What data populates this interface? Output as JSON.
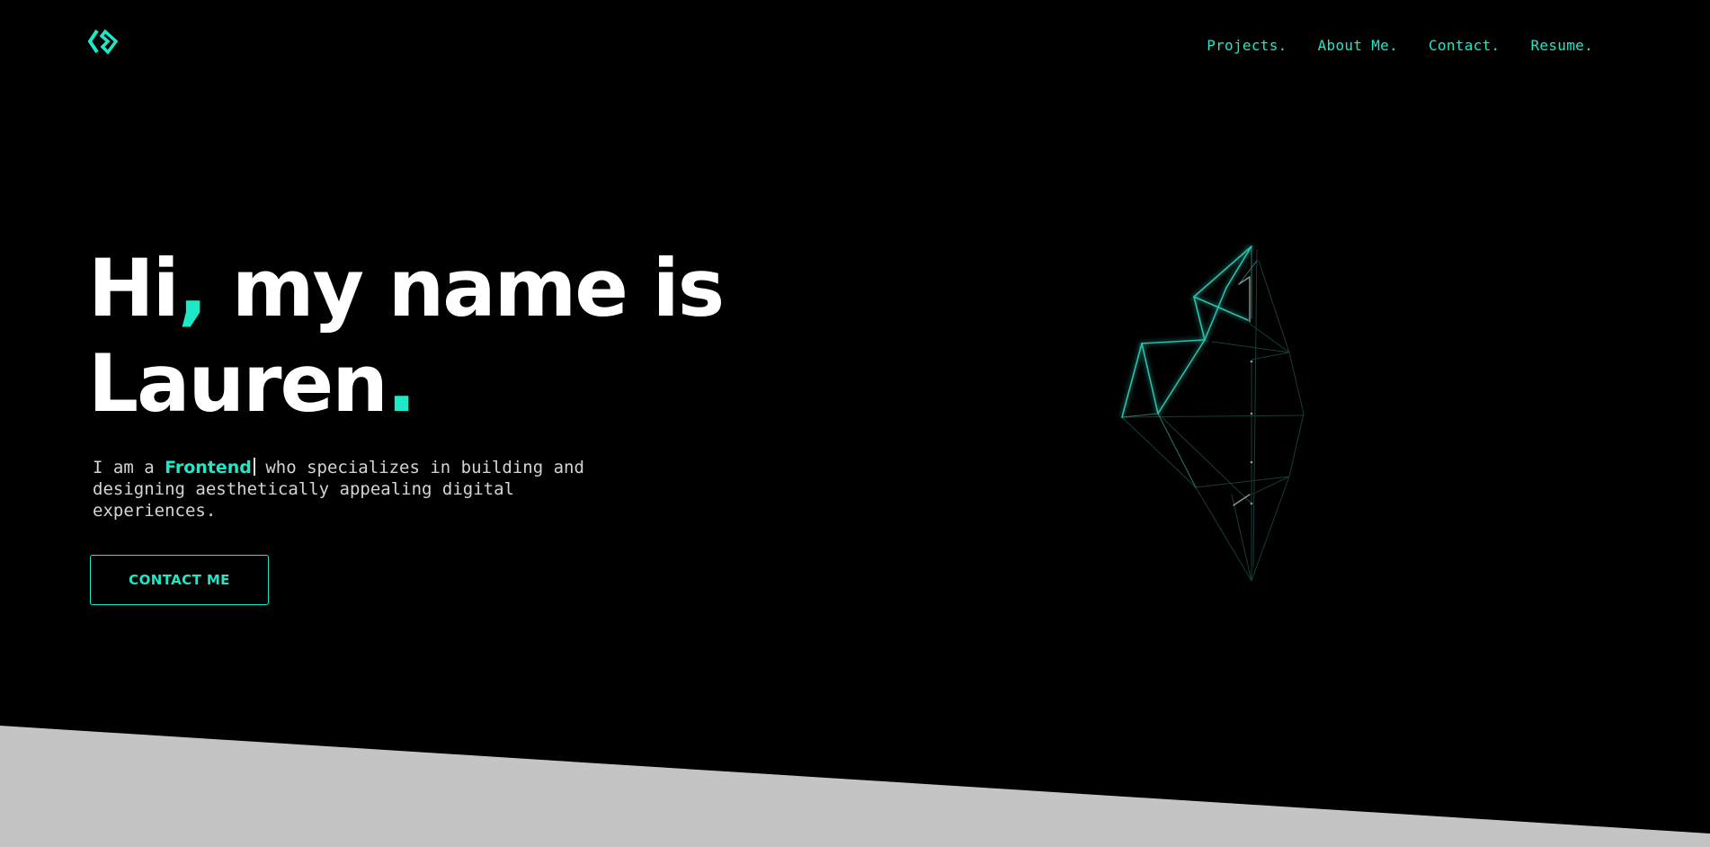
{
  "nav": {
    "items": [
      {
        "label": "Projects."
      },
      {
        "label": "About Me."
      },
      {
        "label": "Contact."
      },
      {
        "label": "Resume."
      }
    ]
  },
  "hero": {
    "title_hi": "Hi",
    "title_comma": ",",
    "title_rest": " my name is",
    "title_name": "Lauren",
    "title_period": ".",
    "intro_prefix": "I am a ",
    "intro_role": "Frontend",
    "intro_suffix": " who specializes in building and designing aesthetically appealing digital experiences.",
    "cta_label": "CONTACT ME"
  },
  "theme": {
    "accent": "#1de9c9",
    "background": "#000000",
    "band": "#c4c4c4",
    "text": "#ffffff"
  },
  "icons": {
    "logo": "double-chevron-logo-icon",
    "decoration": "wireframe-polyhedron-icon"
  }
}
